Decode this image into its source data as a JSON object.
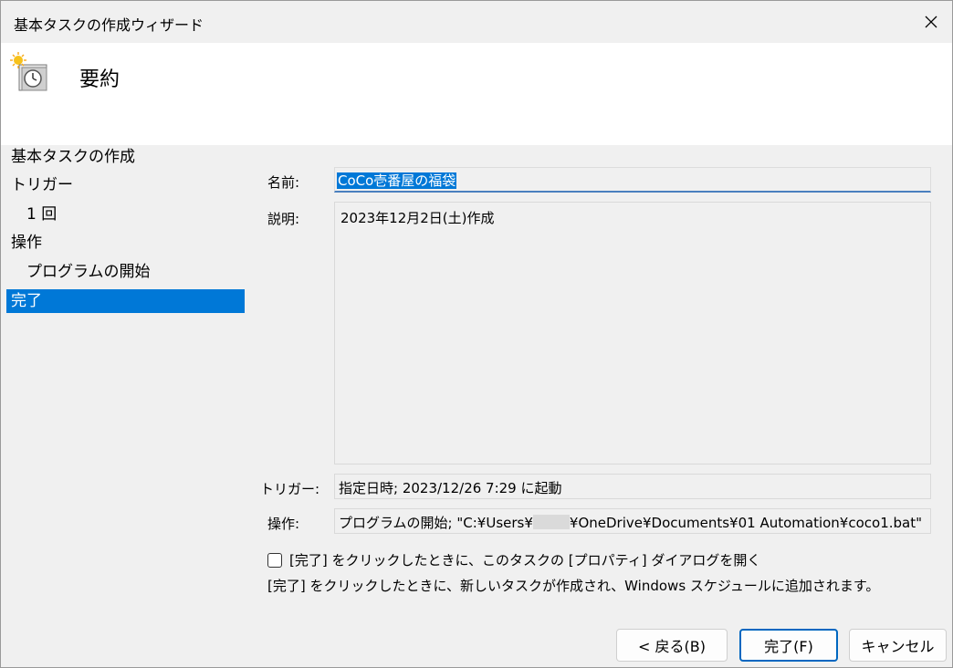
{
  "window": {
    "title": "基本タスクの作成ウィザード"
  },
  "header": {
    "title": "要約",
    "icon": "scheduled-task-clock-icon"
  },
  "nav": {
    "items": [
      {
        "label": "基本タスクの作成"
      },
      {
        "label": "トリガー"
      },
      {
        "label": "1 回"
      },
      {
        "label": "操作"
      },
      {
        "label": "プログラムの開始"
      },
      {
        "label": "完了"
      }
    ],
    "selected": "完了"
  },
  "form": {
    "name_label": "名前:",
    "name_value": "CoCo壱番屋の福袋",
    "desc_label": "説明:",
    "desc_value": "2023年12月2日(土)作成",
    "trigger_label": "トリガー:",
    "trigger_value": "指定日時; 2023/12/26 7:29 に起動",
    "action_label": "操作:",
    "action_prefix": "プログラムの開始; \"C:¥Users¥",
    "action_suffix": "¥OneDrive¥Documents¥01 Automation¥coco1.bat\""
  },
  "options": {
    "open_properties_label": "[完了] をクリックしたときに、このタスクの [プロパティ] ダイアログを開く",
    "open_properties_checked": false,
    "info_text": "[完了] をクリックしたときに、新しいタスクが作成され、Windows スケジュールに追加されます。"
  },
  "buttons": {
    "back": "< 戻る(B)",
    "finish": "完了(F)",
    "cancel": "キャンセル"
  },
  "colors": {
    "accent": "#0078d7",
    "window_bg": "#f0f0f0",
    "header_bg": "#ffffff"
  }
}
